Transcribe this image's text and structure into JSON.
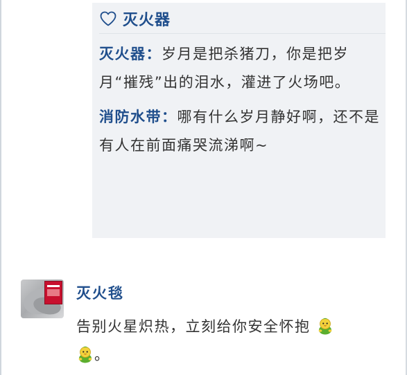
{
  "reply": {
    "title": "灭火器",
    "icon": "heart-outline-icon",
    "items": [
      {
        "speaker": "灭火器",
        "separator": "：",
        "text": "岁月是把杀猪刀，你是把岁月“摧残”出的泪水，灌进了火场吧。"
      },
      {
        "speaker": "消防水带",
        "separator": "：",
        "text": "哪有什么岁月静好啊，还不是有人在前面痛哭流涕啊~"
      }
    ]
  },
  "comment": {
    "author": "灭火毯",
    "avatar": "fire-blanket-avatar",
    "text": "告别火星炽热，立刻给你安全怀抱",
    "emoji": "green-chick-emoji",
    "ending": "。"
  },
  "colors": {
    "accent": "#1f4e8c",
    "panel_bg": "#f0f2f5",
    "text": "#333333"
  }
}
